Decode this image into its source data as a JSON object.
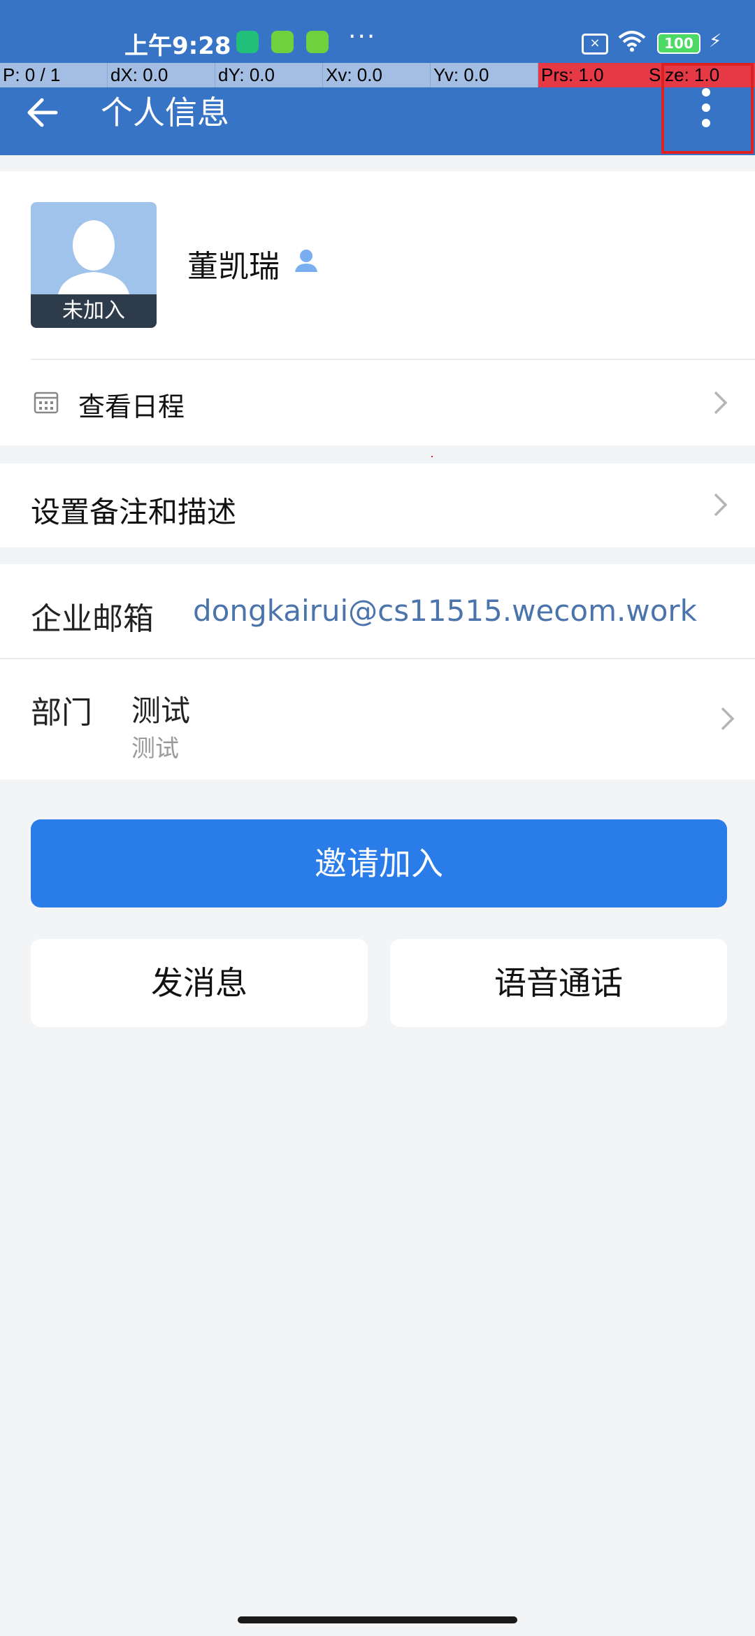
{
  "status_bar": {
    "time": "上午9:28",
    "dots": "···",
    "battery": "100"
  },
  "debug_overlay": {
    "p": "P: 0 / 1",
    "dx": "dX: 0.0",
    "dy": "dY: 0.0",
    "xv": "Xv: 0.0",
    "yv": "Yv: 0.0",
    "prs": "Prs: 1.0",
    "size": "Size: 1.0"
  },
  "header": {
    "title": "个人信息"
  },
  "profile": {
    "avatar_label": "未加入",
    "name": "董凯瑞",
    "schedule_label": "查看日程"
  },
  "remark": {
    "label": "设置备注和描述"
  },
  "info": {
    "email_label": "企业邮箱",
    "email_value": "dongkairui@cs11515.wecom.work",
    "dept_label": "部门",
    "dept_value": "测试",
    "dept_sub": "测试"
  },
  "actions": {
    "invite": "邀请加入",
    "message": "发消息",
    "voice_call": "语音通话"
  },
  "colors": {
    "appbar": "#3874c6",
    "primary_button": "#2a7de9",
    "email_link": "#4b74ad",
    "background": "#f3f4f6"
  }
}
